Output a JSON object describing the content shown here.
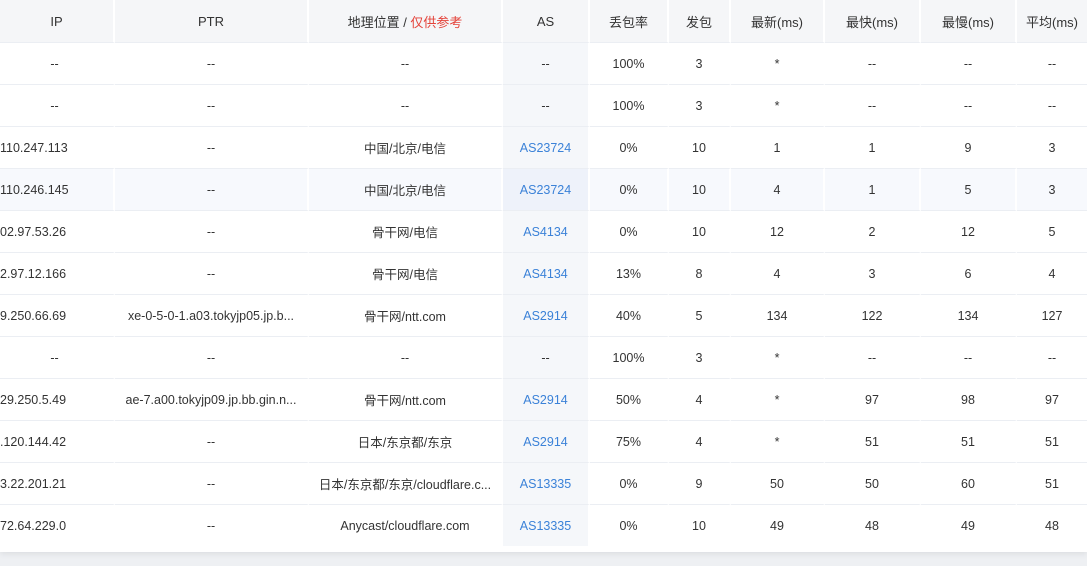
{
  "headers": {
    "ip": "IP",
    "ptr": "PTR",
    "geo": "地理位置",
    "geo_sep": " / ",
    "geo_ref": "仅供参考",
    "as": "AS",
    "loss": "丢包率",
    "sent": "发包",
    "last": "最新(ms)",
    "best": "最快(ms)",
    "worst": "最慢(ms)",
    "avg": "平均(ms)"
  },
  "colors": {
    "link": "#3b82d8",
    "ref_note": "#e4433a"
  },
  "rows": [
    {
      "ip": "--",
      "ptr": "--",
      "geo": "--",
      "as": "--",
      "loss": "100%",
      "sent": "3",
      "last": "*",
      "best": "--",
      "worst": "--",
      "avg": "--"
    },
    {
      "ip": "--",
      "ptr": "--",
      "geo": "--",
      "as": "--",
      "loss": "100%",
      "sent": "3",
      "last": "*",
      "best": "--",
      "worst": "--",
      "avg": "--"
    },
    {
      "ip": "110.247.113",
      "ptr": "--",
      "geo": "中国/北京/电信",
      "as": "AS23724",
      "loss": "0%",
      "sent": "10",
      "last": "1",
      "best": "1",
      "worst": "9",
      "avg": "3"
    },
    {
      "ip": "110.246.145",
      "ptr": "--",
      "geo": "中国/北京/电信",
      "as": "AS23724",
      "loss": "0%",
      "sent": "10",
      "last": "4",
      "best": "1",
      "worst": "5",
      "avg": "3"
    },
    {
      "ip": "02.97.53.26",
      "ptr": "--",
      "geo": "骨干网/电信",
      "as": "AS4134",
      "loss": "0%",
      "sent": "10",
      "last": "12",
      "best": "2",
      "worst": "12",
      "avg": "5"
    },
    {
      "ip": "2.97.12.166",
      "ptr": "--",
      "geo": "骨干网/电信",
      "as": "AS4134",
      "loss": "13%",
      "sent": "8",
      "last": "4",
      "best": "3",
      "worst": "6",
      "avg": "4"
    },
    {
      "ip": "9.250.66.69",
      "ptr": "xe-0-5-0-1.a03.tokyjp05.jp.b...",
      "geo": "骨干网/ntt.com",
      "as": "AS2914",
      "loss": "40%",
      "sent": "5",
      "last": "134",
      "best": "122",
      "worst": "134",
      "avg": "127"
    },
    {
      "ip": "--",
      "ptr": "--",
      "geo": "--",
      "as": "--",
      "loss": "100%",
      "sent": "3",
      "last": "*",
      "best": "--",
      "worst": "--",
      "avg": "--"
    },
    {
      "ip": "29.250.5.49",
      "ptr": "ae-7.a00.tokyjp09.jp.bb.gin.n...",
      "geo": "骨干网/ntt.com",
      "as": "AS2914",
      "loss": "50%",
      "sent": "4",
      "last": "*",
      "best": "97",
      "worst": "98",
      "avg": "97"
    },
    {
      "ip": ".120.144.42",
      "ptr": "--",
      "geo": "日本/东京都/东京",
      "as": "AS2914",
      "loss": "75%",
      "sent": "4",
      "last": "*",
      "best": "51",
      "worst": "51",
      "avg": "51"
    },
    {
      "ip": "3.22.201.21",
      "ptr": "--",
      "geo": "日本/东京都/东京/cloudflare.c...",
      "as": "AS13335",
      "loss": "0%",
      "sent": "9",
      "last": "50",
      "best": "50",
      "worst": "60",
      "avg": "51"
    },
    {
      "ip": "72.64.229.0",
      "ptr": "--",
      "geo": "Anycast/cloudflare.com",
      "as": "AS13335",
      "loss": "0%",
      "sent": "10",
      "last": "49",
      "best": "48",
      "worst": "49",
      "avg": "48"
    }
  ]
}
